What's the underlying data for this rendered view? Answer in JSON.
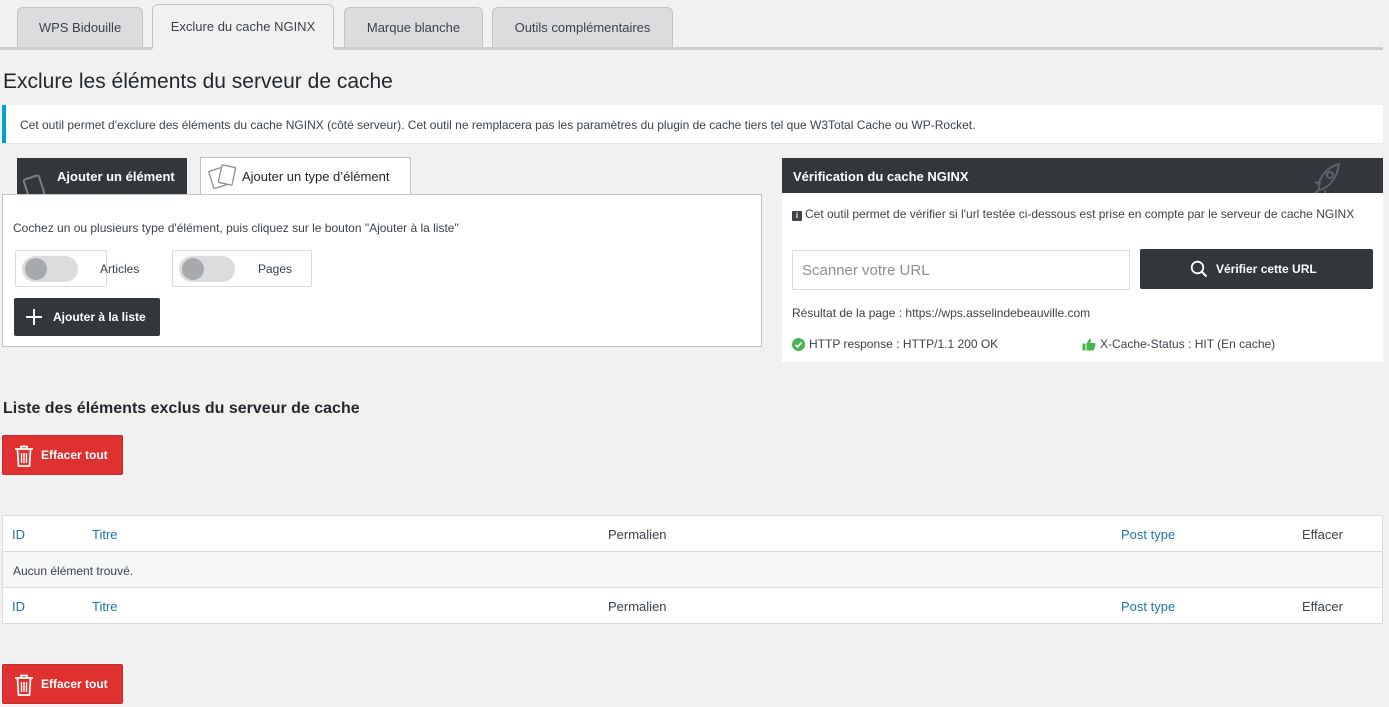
{
  "tabs": [
    {
      "label": "WPS Bidouille",
      "active": false
    },
    {
      "label": "Exclure du cache NGINX",
      "active": true
    },
    {
      "label": "Marque blanche",
      "active": false
    },
    {
      "label": "Outils complémentaires",
      "active": false
    }
  ],
  "page_title": "Exclure les éléments du serveur de cache",
  "notice": "Cet outil permet d'exclure des éléments du cache NGINX (côté serveur). Cet outil ne remplacera pas les paramètres du plugin de cache tiers tel que W3Total Cache ou WP-Rocket.",
  "left": {
    "subtabs": [
      "Ajouter un élément",
      "Ajouter un type d’élément"
    ],
    "instruction": "Cochez un ou plusieurs type d'élément, puis cliquez sur le bouton \"Ajouter à la liste\"",
    "toggles": [
      {
        "label": "Articles",
        "checked": false
      },
      {
        "label": "Pages",
        "checked": false
      }
    ],
    "add_button": "Ajouter à la liste"
  },
  "right": {
    "title": "Vérification du cache NGINX",
    "info": "Cet outil permet de vérifier si l'url testée ci-dessous est prise en compte par le serveur de cache NGINX",
    "url_placeholder": "Scanner votre URL",
    "url_value": "",
    "verify_button": "Vérifier cette URL",
    "result": "Résultat de la page : https://wps.asselindebeauville.com",
    "http_response": "HTTP response : HTTP/1.1 200 OK",
    "cache_status": "X-Cache-Status : HIT (En cache)"
  },
  "list": {
    "title": "Liste des éléments exclus du serveur de cache",
    "clear_button": "Effacer tout",
    "columns": [
      "ID",
      "Titre",
      "Permalien",
      "Post type",
      "Effacer"
    ],
    "empty_message": "Aucun élément trouvé."
  },
  "colors": {
    "dark": "#32373c",
    "red": "#e03131",
    "link": "#2271b1",
    "notice_border": "#00a0d2",
    "success": "#46b450"
  }
}
